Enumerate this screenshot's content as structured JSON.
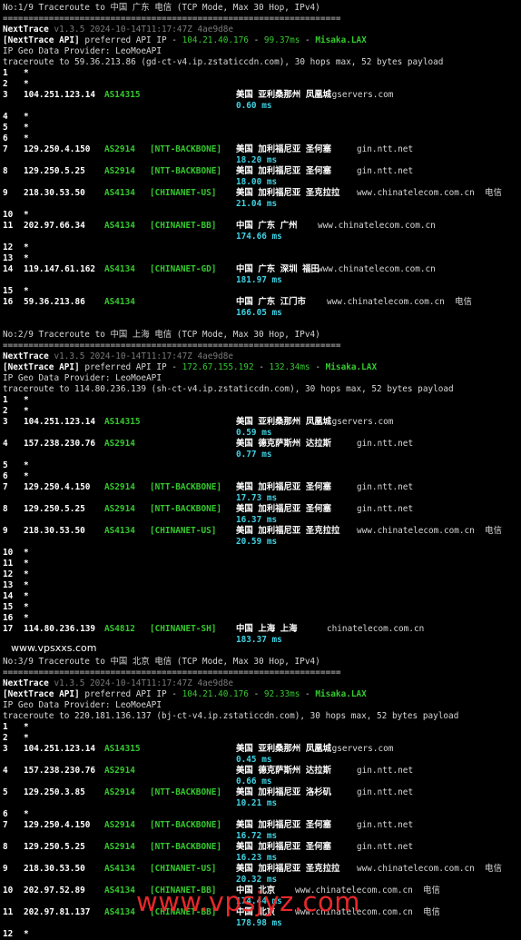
{
  "watermarks": {
    "top": "www.vpsxxs.com",
    "bottom": "www.vpsjyz.com"
  },
  "separator": "==================================================================",
  "blocks": [
    {
      "header": "No:1/9 Traceroute to 中国 广东 电信 (TCP Mode, Max 30 Hop, IPv4)",
      "app": "NextTrace",
      "version": "v1.3.5 2024-10-14T11:17:47Z 4ae9d8e",
      "api_prefix": "[NextTrace API]",
      "api_text": "preferred API IP - ",
      "api_ip": "104.21.40.176",
      "api_dash": " - ",
      "api_ms": "99.37ms",
      "api_dash2": " - ",
      "api_loc": "Misaka.LAX",
      "geo_provider": "IP Geo Data Provider: LeoMoeAPI",
      "trace_line": "traceroute to 59.36.213.86 (gd-ct-v4.ip.zstaticcdn.com), 30 hops max, 52 bytes payload"
    },
    {
      "header": "No:2/9 Traceroute to 中国 上海 电信 (TCP Mode, Max 30 Hop, IPv4)",
      "app": "NextTrace",
      "version": "v1.3.5 2024-10-14T11:17:47Z 4ae9d8e",
      "api_prefix": "[NextTrace API]",
      "api_text": "preferred API IP - ",
      "api_ip": "172.67.155.192",
      "api_dash": " - ",
      "api_ms": "132.34ms",
      "api_dash2": " - ",
      "api_loc": "Misaka.LAX",
      "geo_provider": "IP Geo Data Provider: LeoMoeAPI",
      "trace_line": "traceroute to 114.80.236.139 (sh-ct-v4.ip.zstaticcdn.com), 30 hops max, 52 bytes payload"
    },
    {
      "header": "No:3/9 Traceroute to 中国 北京 电信 (TCP Mode, Max 30 Hop, IPv4)",
      "app": "NextTrace",
      "version": "v1.3.5 2024-10-14T11:17:47Z 4ae9d8e",
      "api_prefix": "[NextTrace API]",
      "api_text": "preferred API IP - ",
      "api_ip": "104.21.40.176",
      "api_dash": " - ",
      "api_ms": "92.33ms",
      "api_dash2": " - ",
      "api_loc": "Misaka.LAX",
      "geo_provider": "IP Geo Data Provider: LeoMoeAPI",
      "trace_line": "traceroute to 220.181.136.137 (bj-ct-v4.ip.zstaticcdn.com), 30 hops max, 52 bytes payload"
    }
  ],
  "hops": {
    "b1": [
      {
        "n": "1",
        "star": "*"
      },
      {
        "n": "2",
        "star": "*"
      },
      {
        "n": "3",
        "ip": "104.251.123.14",
        "asn": "AS14315",
        "tag": "",
        "geo": "美国 亚利桑那州 凤凰城",
        "host": "lgservers.com",
        "hostcol": "host2",
        "rtt": "0.60 ms"
      },
      {
        "n": "4",
        "star": "*"
      },
      {
        "n": "5",
        "star": "*"
      },
      {
        "n": "6",
        "star": "*"
      },
      {
        "n": "7",
        "ip": "129.250.4.150",
        "asn": "AS2914",
        "tag": "[NTT-BACKBONE]",
        "geo": "美国 加利福尼亚 圣何塞",
        "host": "gin.ntt.net",
        "hostcol": "host",
        "rtt": "18.20 ms"
      },
      {
        "n": "8",
        "ip": "129.250.5.25",
        "asn": "AS2914",
        "tag": "[NTT-BACKBONE]",
        "geo": "美国 加利福尼亚 圣何塞",
        "host": "gin.ntt.net",
        "hostcol": "host",
        "rtt": "18.00 ms"
      },
      {
        "n": "9",
        "ip": "218.30.53.50",
        "asn": "AS4134",
        "tag": "[CHINANET-US]",
        "geo": "美国 加利福尼亚 圣克拉拉",
        "host": "www.chinatelecom.com.cn  电信",
        "hostcol": "host",
        "rtt": "21.04 ms"
      },
      {
        "n": "10",
        "star": "*"
      },
      {
        "n": "11",
        "ip": "202.97.66.34",
        "asn": "AS4134",
        "tag": "[CHINANET-BB]",
        "geo": "中国 广东 广州",
        "host": "www.chinatelecom.com.cn",
        "hostcol": "host3",
        "rtt": "174.66 ms"
      },
      {
        "n": "12",
        "star": "*"
      },
      {
        "n": "13",
        "star": "*"
      },
      {
        "n": "14",
        "ip": "119.147.61.162",
        "asn": "AS4134",
        "tag": "[CHINANET-GD]",
        "geo": "中国 广东 深圳 福田",
        "host": "www.chinatelecom.com.cn",
        "hostcol": "host3",
        "rtt": "181.97 ms"
      },
      {
        "n": "15",
        "star": "*"
      },
      {
        "n": "16",
        "ip": "59.36.213.86",
        "asn": "AS4134",
        "tag": "",
        "geo": "中国 广东 江门市",
        "host": "www.chinatelecom.com.cn  电信",
        "hostcol": "host2",
        "rtt": "166.05 ms"
      }
    ],
    "b2": [
      {
        "n": "1",
        "star": "*"
      },
      {
        "n": "2",
        "star": "*"
      },
      {
        "n": "3",
        "ip": "104.251.123.14",
        "asn": "AS14315",
        "tag": "",
        "geo": "美国 亚利桑那州 凤凰城",
        "host": "lgservers.com",
        "hostcol": "host2",
        "rtt": "0.59 ms"
      },
      {
        "n": "4",
        "ip": "157.238.230.76",
        "asn": "AS2914",
        "tag": "",
        "geo": "美国 德克萨斯州 达拉斯",
        "host": "gin.ntt.net",
        "hostcol": "host",
        "rtt": "0.77 ms"
      },
      {
        "n": "5",
        "star": "*"
      },
      {
        "n": "6",
        "star": "*"
      },
      {
        "n": "7",
        "ip": "129.250.4.150",
        "asn": "AS2914",
        "tag": "[NTT-BACKBONE]",
        "geo": "美国 加利福尼亚 圣何塞",
        "host": "gin.ntt.net",
        "hostcol": "host",
        "rtt": "17.73 ms"
      },
      {
        "n": "8",
        "ip": "129.250.5.25",
        "asn": "AS2914",
        "tag": "[NTT-BACKBONE]",
        "geo": "美国 加利福尼亚 圣何塞",
        "host": "gin.ntt.net",
        "hostcol": "host",
        "rtt": "16.37 ms"
      },
      {
        "n": "9",
        "ip": "218.30.53.50",
        "asn": "AS4134",
        "tag": "[CHINANET-US]",
        "geo": "美国 加利福尼亚 圣克拉拉",
        "host": "www.chinatelecom.com.cn  电信",
        "hostcol": "host",
        "rtt": "20.59 ms"
      },
      {
        "n": "10",
        "star": "*"
      },
      {
        "n": "11",
        "star": "*"
      },
      {
        "n": "12",
        "star": "*"
      },
      {
        "n": "13",
        "star": "*"
      },
      {
        "n": "14",
        "star": "*"
      },
      {
        "n": "15",
        "star": "*"
      },
      {
        "n": "16",
        "star": "*"
      },
      {
        "n": "17",
        "ip": "114.80.236.139",
        "asn": "AS4812",
        "tag": "[CHINANET-SH]",
        "geo": "中国 上海 上海",
        "host": "chinatelecom.com.cn",
        "hostcol": "host2",
        "rtt": "183.37 ms"
      }
    ],
    "b3": [
      {
        "n": "1",
        "star": "*"
      },
      {
        "n": "2",
        "star": "*"
      },
      {
        "n": "3",
        "ip": "104.251.123.14",
        "asn": "AS14315",
        "tag": "",
        "geo": "美国 亚利桑那州 凤凰城",
        "host": "lgservers.com",
        "hostcol": "host2",
        "rtt": "0.45 ms"
      },
      {
        "n": "4",
        "ip": "157.238.230.76",
        "asn": "AS2914",
        "tag": "",
        "geo": "美国 德克萨斯州 达拉斯",
        "host": "gin.ntt.net",
        "hostcol": "host",
        "rtt": "0.66 ms"
      },
      {
        "n": "5",
        "ip": "129.250.3.85",
        "asn": "AS2914",
        "tag": "[NTT-BACKBONE]",
        "geo": "美国 加利福尼亚 洛杉矶",
        "host": "gin.ntt.net",
        "hostcol": "host",
        "rtt": "10.21 ms"
      },
      {
        "n": "6",
        "star": "*"
      },
      {
        "n": "7",
        "ip": "129.250.4.150",
        "asn": "AS2914",
        "tag": "[NTT-BACKBONE]",
        "geo": "美国 加利福尼亚 圣何塞",
        "host": "gin.ntt.net",
        "hostcol": "host",
        "rtt": "16.72 ms"
      },
      {
        "n": "8",
        "ip": "129.250.5.25",
        "asn": "AS2914",
        "tag": "[NTT-BACKBONE]",
        "geo": "美国 加利福尼亚 圣何塞",
        "host": "gin.ntt.net",
        "hostcol": "host",
        "rtt": "16.23 ms"
      },
      {
        "n": "9",
        "ip": "218.30.53.50",
        "asn": "AS4134",
        "tag": "[CHINANET-US]",
        "geo": "美国 加利福尼亚 圣克拉拉",
        "host": "www.chinatelecom.com.cn  电信",
        "hostcol": "host",
        "rtt": "20.32 ms"
      },
      {
        "n": "10",
        "ip": "202.97.52.89",
        "asn": "AS4134",
        "tag": "[CHINANET-BB]",
        "geo": "中国 北京",
        "host": "www.chinatelecom.com.cn  电信",
        "hostcol": "host4",
        "rtt": "174.44 ms"
      },
      {
        "n": "11",
        "ip": "202.97.81.137",
        "asn": "AS4134",
        "tag": "[CHINANET-BB]",
        "geo": "中国 北京",
        "host": "www.chinatelecom.com.cn  电信",
        "hostcol": "host4",
        "rtt": "178.98 ms"
      },
      {
        "n": "12",
        "star": "*"
      }
    ]
  }
}
